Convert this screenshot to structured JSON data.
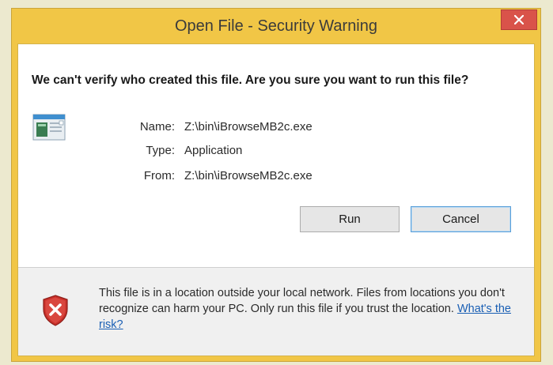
{
  "window": {
    "title": "Open File - Security Warning"
  },
  "dialog": {
    "question": "We can't verify who created this file. Are you sure you want to run this file?",
    "details": [
      {
        "label": "Name:",
        "value": "Z:\\bin\\iBrowseMB2c.exe"
      },
      {
        "label": "Type:",
        "value": "Application"
      },
      {
        "label": "From:",
        "value": "Z:\\bin\\iBrowseMB2c.exe"
      }
    ],
    "buttons": {
      "run": "Run",
      "cancel": "Cancel"
    },
    "warning": {
      "text": "This file is in a location outside your local network. Files from locations you don't recognize can harm your PC. Only run this file if you trust the location. ",
      "link": "What's the risk?"
    }
  },
  "icons": {
    "close": "close-icon",
    "file": "application-file-icon",
    "shield": "shield-warning-icon"
  },
  "colors": {
    "title_bar": "#f1c646",
    "close_button": "#d9534a",
    "link": "#1a5fb4",
    "shield_red": "#c8302a"
  }
}
